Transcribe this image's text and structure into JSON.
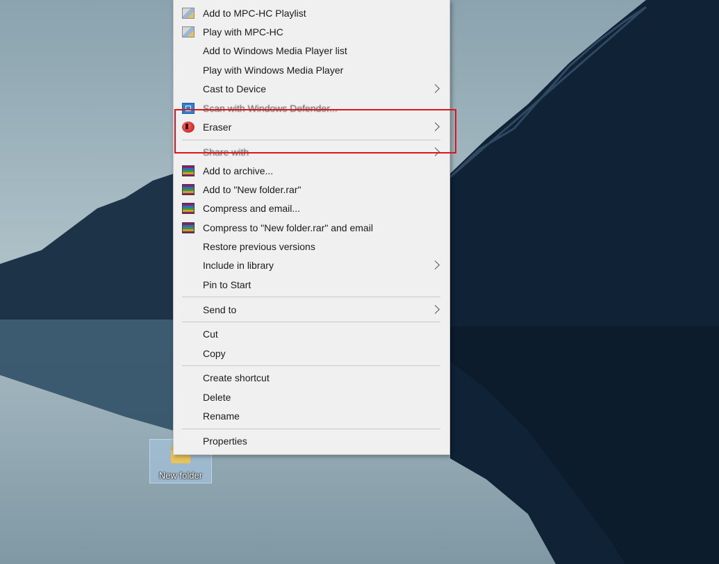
{
  "desktop": {
    "icon_label": "New folder"
  },
  "menu": {
    "items": {
      "add_mpc_playlist": "Add to MPC-HC Playlist",
      "play_mpc": "Play with MPC-HC",
      "add_wmp_list": "Add to Windows Media Player list",
      "play_wmp": "Play with Windows Media Player",
      "cast": "Cast to Device",
      "scan_defender": "Scan with Windows Defender...",
      "eraser": "Eraser",
      "share_with": "Share with",
      "add_archive": "Add to archive...",
      "add_rar": "Add to \"New folder.rar\"",
      "compress_email": "Compress and email...",
      "compress_rar_email": "Compress to \"New folder.rar\" and email",
      "restore": "Restore previous versions",
      "include_library": "Include in library",
      "pin_start": "Pin to Start",
      "send_to": "Send to",
      "cut": "Cut",
      "copy": "Copy",
      "create_shortcut": "Create shortcut",
      "delete": "Delete",
      "rename": "Rename",
      "properties": "Properties"
    },
    "icons": {
      "mpc": "mpc-hc-icon",
      "defender": "windows-defender-icon",
      "eraser": "eraser-icon",
      "winrar": "winrar-icon",
      "submenu": "chevron-right-icon"
    }
  },
  "colors": {
    "highlight_box": "#e0121b",
    "menu_bg": "#f0f0f0"
  }
}
